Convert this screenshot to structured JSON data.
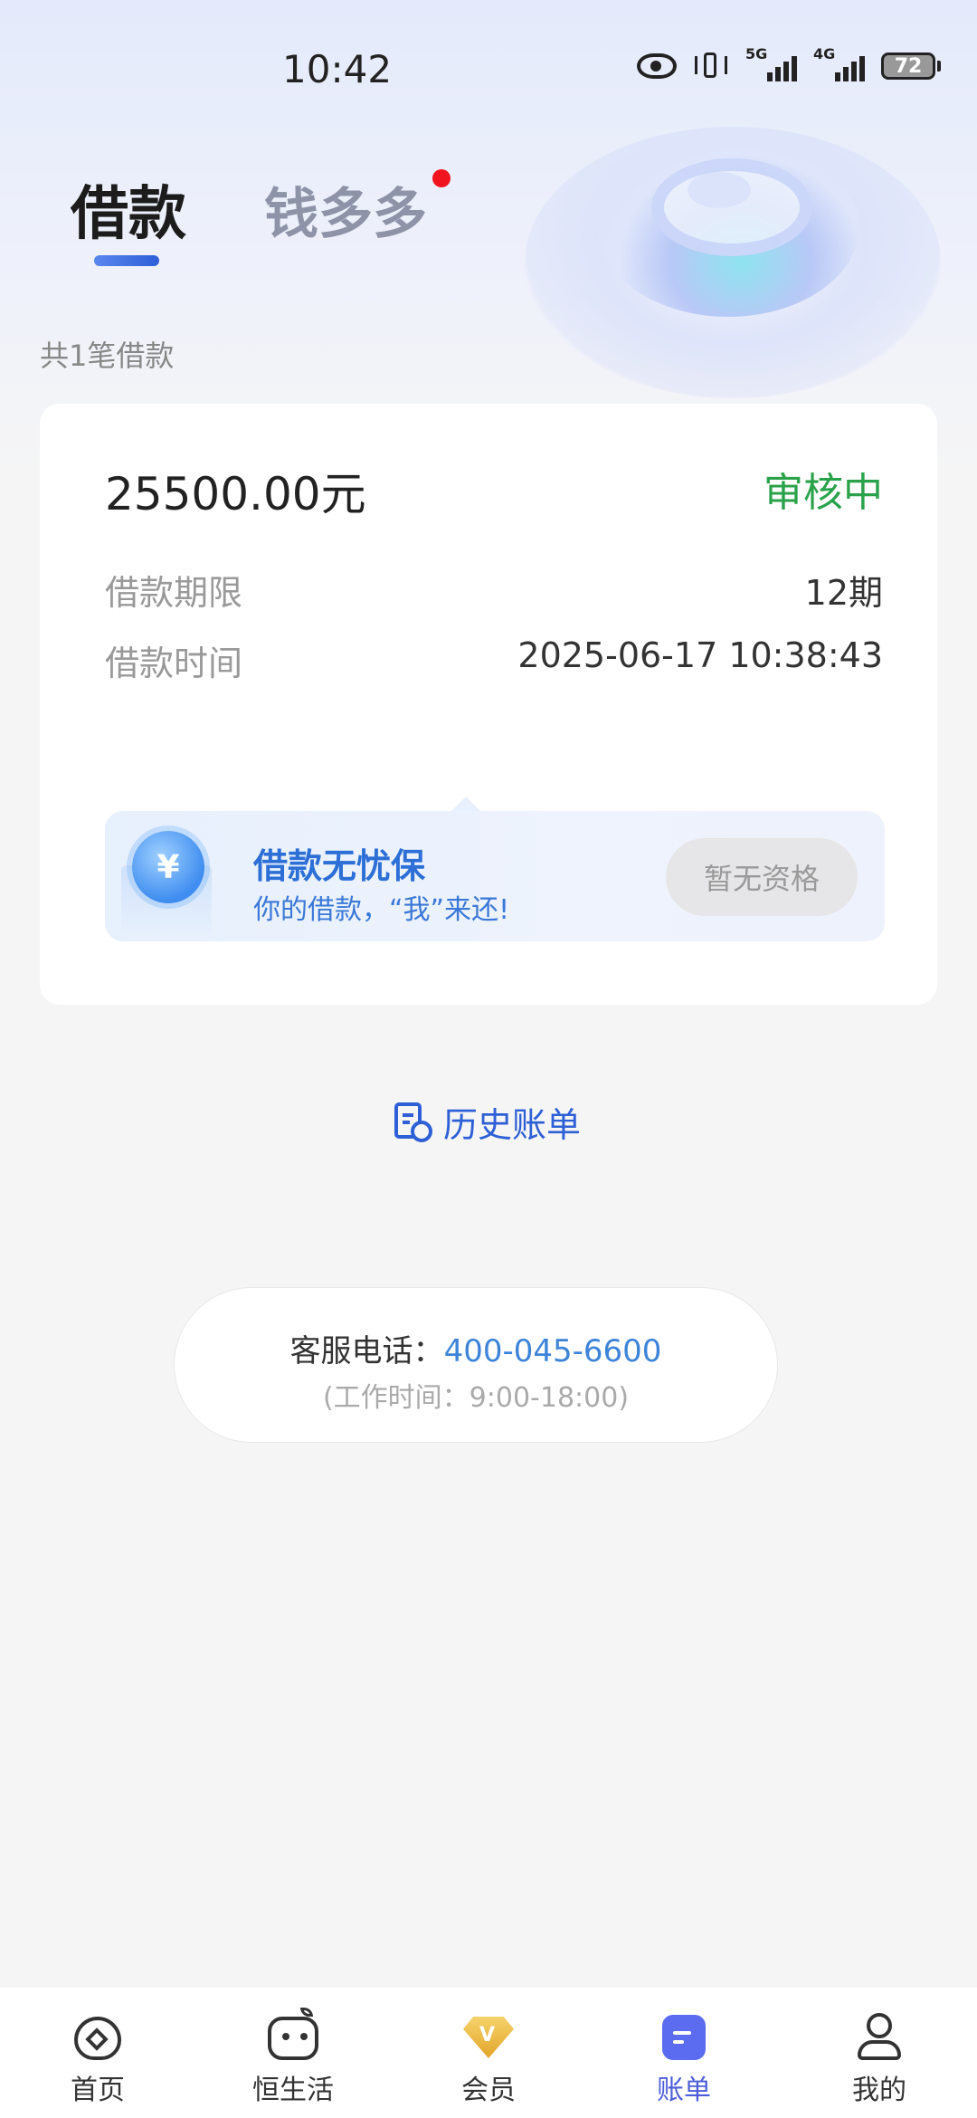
{
  "status_bar": {
    "time": "10:42",
    "net1": "5G",
    "net2": "4G",
    "battery": "72"
  },
  "header": {
    "tab_active": "借款",
    "tab_inactive": "钱多多",
    "loan_count": "共1笔借款"
  },
  "loan_card": {
    "amount": "25500.00元",
    "status": "审核中",
    "term_label": "借款期限",
    "term_value": "12期",
    "time_label": "借款时间",
    "time_value": "2025-06-17 10:38:43",
    "banner": {
      "coin_symbol": "¥",
      "title": "借款无忧保",
      "subtitle": "你的借款，“我”来还!",
      "button": "暂无资格"
    }
  },
  "history": {
    "label": "历史账单"
  },
  "service": {
    "label": "客服电话：",
    "phone": "400-045-6600",
    "hours": "(工作时间：9:00-18:00)"
  },
  "nav": {
    "items": [
      {
        "label": "首页"
      },
      {
        "label": "恒生活"
      },
      {
        "label": "会员"
      },
      {
        "label": "账单"
      },
      {
        "label": "我的"
      }
    ]
  },
  "colors": {
    "accent": "#2d5fd6",
    "status_green": "#2aa24a",
    "phone_blue": "#3d84d9",
    "nav_active": "#4b5dd8",
    "red_dot": "#f0141e"
  }
}
